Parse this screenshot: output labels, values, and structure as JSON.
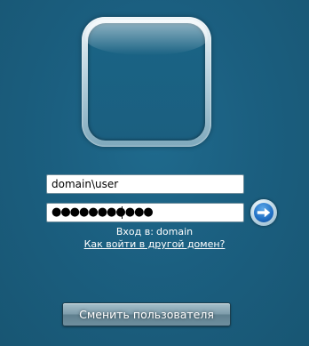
{
  "login": {
    "username_value": "domain\\user",
    "password_masked": "●●●●●●●●●●●",
    "domain_label": "Вход в:",
    "domain_name": "domain",
    "other_domain_link": "Как войти в другой домен?",
    "switch_user_label": "Сменить пользователя"
  },
  "icons": {
    "submit": "arrow-right-icon"
  },
  "colors": {
    "background": "#1b5f80",
    "go_button": "#1f6fc4"
  }
}
